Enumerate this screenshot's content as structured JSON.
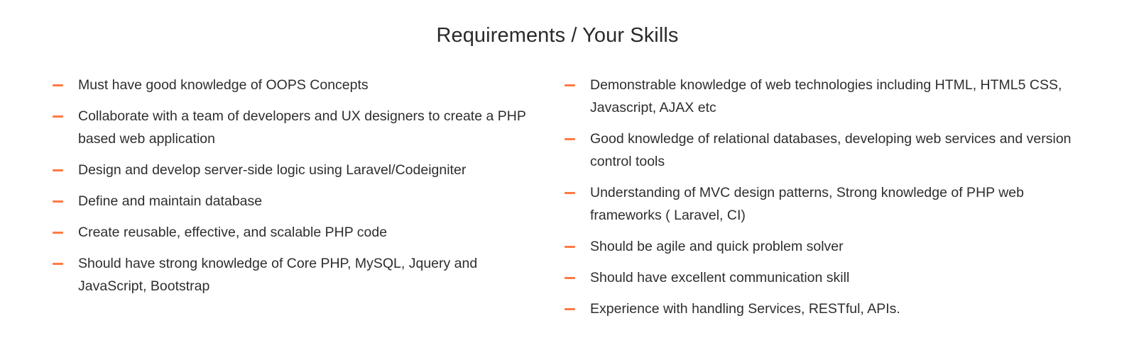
{
  "section": {
    "title": "Requirements / Your Skills"
  },
  "accent_color": "#ff7a45",
  "bullet_icon": "dash-icon",
  "left_items": [
    "Must have good knowledge of OOPS Concepts",
    "Collaborate with a team of developers and UX designers to create a PHP based web application",
    "Design and develop server-side logic using Laravel/Codeigniter",
    "Define and maintain database",
    "Create reusable, effective, and scalable PHP code",
    "Should have strong knowledge of Core PHP, MySQL, Jquery and JavaScript, Bootstrap"
  ],
  "right_items": [
    "Demonstrable knowledge of web technologies including HTML, HTML5 CSS, Javascript, AJAX etc",
    "Good knowledge of relational databases, developing web services and version control tools",
    "Understanding of MVC design patterns, Strong knowledge of PHP web frameworks ( Laravel, CI)",
    "Should be agile and quick problem solver",
    "Should have excellent communication skill",
    "Experience with handling Services, RESTful, APIs."
  ]
}
